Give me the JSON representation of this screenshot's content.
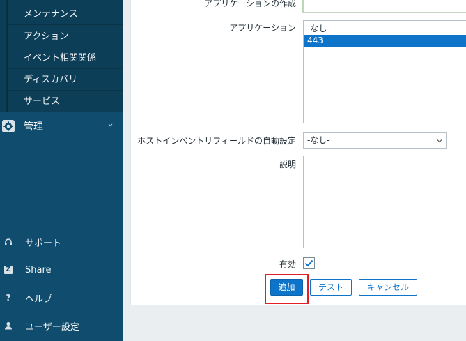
{
  "sidebar": {
    "submenu": [
      "メンテナンス",
      "アクション",
      "イベント相関関係",
      "ディスカバリ",
      "サービス"
    ],
    "admin": {
      "label": "管理",
      "icon": "gear-icon"
    },
    "bottom": [
      {
        "label": "サポート",
        "icon": "headset-icon"
      },
      {
        "label": "Share",
        "icon": "share-z-icon",
        "glyph": "Z"
      },
      {
        "label": "ヘルプ",
        "icon": "help-icon",
        "glyph": "?"
      },
      {
        "label": "ユーザー設定",
        "icon": "user-icon"
      }
    ]
  },
  "form": {
    "create_app_label": "アプリケーションの作成",
    "application_label": "アプリケーション",
    "application_options": [
      "-なし-",
      "443"
    ],
    "application_selected": "443",
    "inventory_label": "ホストインベントリフィールドの自動設定",
    "inventory_value": "-なし-",
    "description_label": "説明",
    "enabled_label": "有効",
    "enabled_checked": true
  },
  "buttons": {
    "add": "追加",
    "test": "テスト",
    "cancel": "キャンセル"
  },
  "colors": {
    "sidebar": "#0f4c6d",
    "submenu": "#0d3e58",
    "accent": "#0e74c9",
    "highlight": "#e01f26"
  }
}
